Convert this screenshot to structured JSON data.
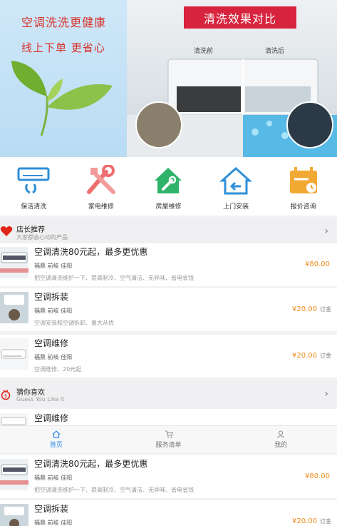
{
  "banner": {
    "slogan_line1": "空调洗洗更健康",
    "slogan_line2": "线上下单 更省心",
    "badge": "清洗效果对比",
    "label_before": "清洗前",
    "label_after": "清洗后"
  },
  "categories": [
    {
      "label": "保洁清洗",
      "icon": "air-conditioner-icon",
      "color": "#2f8fd8"
    },
    {
      "label": "家电维修",
      "icon": "tools-icon",
      "color": "#ee6e6e"
    },
    {
      "label": "房屋维修",
      "icon": "house-wrench-icon",
      "color": "#2fb36b"
    },
    {
      "label": "上门安装",
      "icon": "home-return-icon",
      "color": "#2f8fd8"
    },
    {
      "label": "报价咨询",
      "icon": "calendar-icon",
      "color": "#f2a933"
    }
  ],
  "section_recommend": {
    "title": "店长推荐",
    "subtitle": "大家都会心动的产品",
    "icon": "heart-icon"
  },
  "section_guess": {
    "title": "猜你喜欢",
    "subtitle": "Guess You Like It",
    "icon": "bag-icon"
  },
  "products": [
    {
      "title": "空调清洗80元起，最多更优惠",
      "location": "福鼎 前岐 佳阳",
      "desc": "把空调清洗维护一下、提高制冷、空气清洁、无异味、省电省钱",
      "price": "¥80.00",
      "unit": ""
    },
    {
      "title": "空调拆装",
      "location": "福鼎 前岐 佳阳",
      "desc": "空调安装和空调拆卸、量大从优",
      "price": "¥20.00",
      "unit": "订金"
    },
    {
      "title": "空调维修",
      "location": "福鼎 前岐 佳阳",
      "desc": "空调维修、20元起",
      "price": "¥20.00",
      "unit": "订金"
    }
  ],
  "guess_items": [
    {
      "title": "空调维修"
    },
    {
      "title": "空调清洗80元起，最多更优惠",
      "location": "福鼎 前岐 佳阳",
      "desc": "把空调清洗维护一下、提高制冷、空气清洁、无异味、省电省钱",
      "price": "¥80.00",
      "unit": ""
    },
    {
      "title": "空调拆装",
      "location": "福鼎 前岐 佳阳",
      "price": "¥20.00",
      "unit": "订金"
    }
  ],
  "tabs": [
    {
      "label": "首页",
      "icon": "home-icon",
      "active": true
    },
    {
      "label": "服务清单",
      "icon": "cart-icon",
      "active": false
    },
    {
      "label": "我的",
      "icon": "user-icon",
      "active": false
    }
  ],
  "colors": {
    "accent": "#2e8ae6",
    "price": "#f08a1c",
    "brand_red": "#d8233e"
  }
}
